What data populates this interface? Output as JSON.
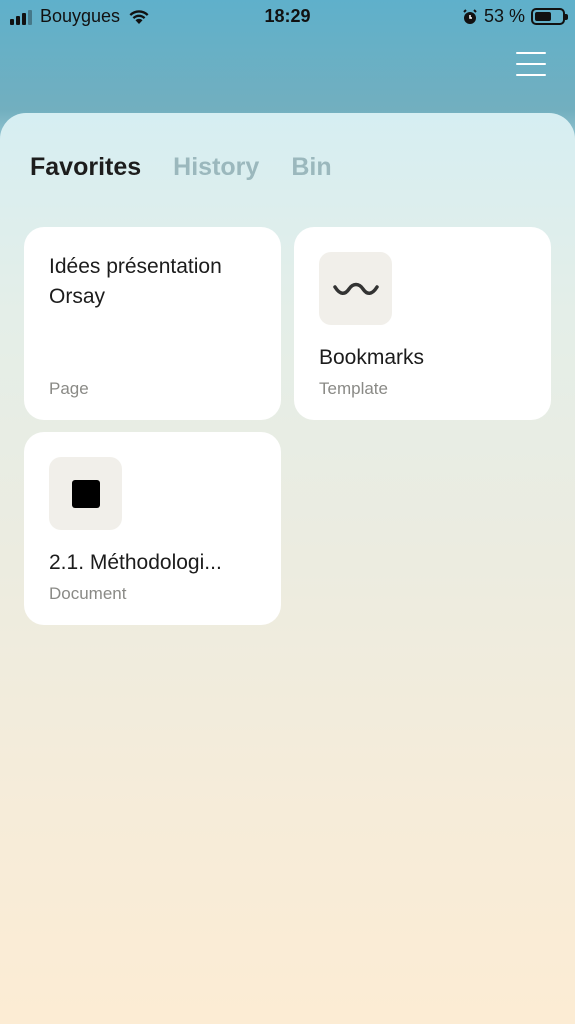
{
  "status_bar": {
    "carrier": "Bouygues",
    "time": "18:29",
    "battery_percent": "53 %",
    "battery_level": 0.53
  },
  "header": {
    "menu_icon": "hamburger-menu-icon"
  },
  "tabs": [
    {
      "label": "Favorites",
      "active": true
    },
    {
      "label": "History",
      "active": false
    },
    {
      "label": "Bin",
      "active": false
    }
  ],
  "cards": [
    {
      "title": "Idées présentation Orsay",
      "type": "Page",
      "icon": null
    },
    {
      "title": "Bookmarks",
      "type": "Template",
      "icon": "wave-icon"
    },
    {
      "title": "2.1. Méthodologi...",
      "type": "Document",
      "icon": "black-square-icon"
    }
  ],
  "colors": {
    "header_top": "#5fb0cb",
    "tab_active": "#1d1d1d",
    "tab_inactive": "#9bb8bd",
    "card_bg": "#ffffff",
    "icon_box_bg": "#f1efea"
  }
}
